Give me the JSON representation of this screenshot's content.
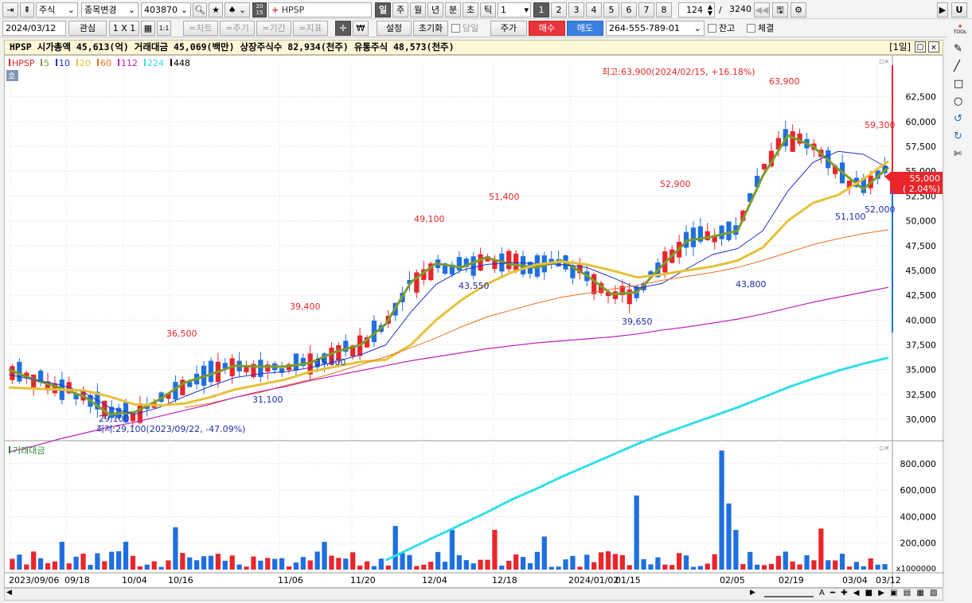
{
  "toolbar1": {
    "asset_type": "주식",
    "change_label": "종목변경",
    "code": "403870",
    "symbol": "HPSP",
    "periods": [
      "일",
      "주",
      "월",
      "년",
      "분",
      "초",
      "틱"
    ],
    "period_value": "1",
    "n_buttons": [
      "1",
      "2",
      "3",
      "4",
      "5",
      "6",
      "7",
      "8"
    ],
    "count": "124",
    "total": "3240",
    "right_btn": "U"
  },
  "toolbar2": {
    "date": "2024/03/12",
    "fav": "관심",
    "layout": "1 X 1",
    "one_one": "1:1",
    "chart_btns": [
      "=차트",
      "=주기",
      "=기간",
      "=지표"
    ],
    "settings": "설정",
    "reset": "초기화",
    "sameday": "당일",
    "price": "주가",
    "buy": "매수",
    "sell": "매도",
    "account": "264-555-789-01",
    "balance": "잔고",
    "fill": "체결"
  },
  "infobar": {
    "text": "HPSP  시가총액 45,613(억)  거래대금 45,069(백만)  상장주식수 82,934(천주)  유통주식 48,573(천주)",
    "period_tag": "[1일]"
  },
  "legend": {
    "items": [
      {
        "label": "HPSP",
        "color": "#e8262c"
      },
      {
        "label": "5",
        "color": "#7c9c2c"
      },
      {
        "label": "10",
        "color": "#2230c8"
      },
      {
        "label": "20",
        "color": "#e6c13a"
      },
      {
        "label": "60",
        "color": "#f07020"
      },
      {
        "label": "112",
        "color": "#c020c0"
      },
      {
        "label": "224",
        "color": "#30e0e8"
      },
      {
        "label": "448",
        "color": "#000000"
      }
    ],
    "ho": "호"
  },
  "colors": {
    "up": "#e8262c",
    "down": "#1f6fe0",
    "grid": "#d8d8d8"
  },
  "volume_label": "거래대금",
  "volume_unit": "x1000000",
  "price_tag": {
    "price": "55,000",
    "change": "( 2.04%)"
  },
  "chart_data": [
    {
      "type": "candlestick",
      "title": "HPSP",
      "ylim": [
        28000,
        66000
      ],
      "yticks": [
        30000,
        32500,
        35000,
        37500,
        40000,
        42500,
        45000,
        47500,
        50000,
        52500,
        55000,
        57500,
        60000,
        62500
      ],
      "ytick_labels": [
        "30,000",
        "32,500",
        "35,000",
        "37,500",
        "40,000",
        "42,500",
        "45,000",
        "47,500",
        "50,000",
        "52,500",
        "55,000",
        "57,500",
        "60,000",
        "62,500"
      ],
      "xticks": [
        "2023/09/06",
        "09/18",
        "10/04",
        "10/16",
        "11/06",
        "11/20",
        "12/04",
        "12/18",
        "2024/01/02",
        "01/15",
        "02/05",
        "02/19",
        "03/04",
        "03/12"
      ],
      "annotations": [
        {
          "label": "63,900",
          "kind": "high"
        },
        {
          "label": "최고:63,900(2024/02/15, +16.18%)",
          "kind": "high_note"
        },
        {
          "label": "29,100",
          "kind": "low"
        },
        {
          "label": "최저:29,100(2023/09/22, -47.09%)",
          "kind": "low_note"
        },
        {
          "label": "36,500",
          "kind": "high"
        },
        {
          "label": "31,100",
          "kind": "low"
        },
        {
          "label": "39,400",
          "kind": "high"
        },
        {
          "label": "35,300",
          "kind": "low"
        },
        {
          "label": "49,100",
          "kind": "high"
        },
        {
          "label": "43,550",
          "kind": "low"
        },
        {
          "label": "51,400",
          "kind": "high"
        },
        {
          "label": "39,650",
          "kind": "low"
        },
        {
          "label": "52,900",
          "kind": "high"
        },
        {
          "label": "43,800",
          "kind": "low"
        },
        {
          "label": "59,300",
          "kind": "high"
        },
        {
          "label": "51,100",
          "kind": "low"
        },
        {
          "label": "52,000",
          "kind": "low"
        }
      ],
      "series": [
        {
          "name": "5",
          "kind": "ma",
          "values": [
            35000,
            34000,
            33200,
            32300,
            30500,
            30700,
            32000,
            33700,
            34500,
            35400,
            35300,
            35300,
            35700,
            36800,
            37500,
            39600,
            43800,
            45700,
            45300,
            46300,
            45600,
            45300,
            46000,
            44500,
            42600,
            42800,
            45500,
            48000,
            48400,
            49000,
            54500,
            58600,
            57500,
            55200,
            53200,
            55400
          ]
        },
        {
          "name": "10",
          "kind": "ma",
          "values": [
            34500,
            34000,
            33500,
            32700,
            31200,
            30500,
            31200,
            32300,
            33300,
            34200,
            34600,
            34800,
            35200,
            35800,
            36500,
            37500,
            40800,
            43600,
            45000,
            45600,
            45800,
            45700,
            45600,
            45300,
            44300,
            43200,
            43700,
            45200,
            46600,
            47200,
            49000,
            53000,
            55900,
            57000,
            56700,
            55300
          ]
        },
        {
          "name": "20",
          "kind": "ma",
          "values": [
            33200,
            33100,
            33000,
            32900,
            32300,
            31500,
            31400,
            31600,
            32200,
            33000,
            33500,
            34000,
            34800,
            35300,
            35800,
            36000,
            37500,
            40000,
            42000,
            43600,
            44800,
            45600,
            45900,
            45600,
            45000,
            44300,
            44600,
            45000,
            45400,
            46000,
            47300,
            50000,
            51800,
            52600,
            54200,
            56000
          ]
        },
        {
          "name": "60",
          "kind": "ma",
          "values": [
            null,
            null,
            null,
            null,
            null,
            null,
            null,
            31200,
            31600,
            32200,
            32700,
            33400,
            34000,
            34700,
            35500,
            36300,
            37200,
            38200,
            39300,
            40300,
            41000,
            41700,
            42300,
            42700,
            43100,
            43500,
            44000,
            44400,
            44800,
            45300,
            46000,
            46800,
            47600,
            48200,
            48700,
            49100
          ]
        },
        {
          "name": "112",
          "kind": "ma",
          "values": [
            26700,
            27300,
            28000,
            28600,
            29200,
            29700,
            30300,
            30900,
            31500,
            32200,
            32800,
            33300,
            33900,
            34400,
            34900,
            35400,
            35900,
            36300,
            36700,
            37100,
            37400,
            37700,
            37900,
            38100,
            38300,
            38600,
            39000,
            39300,
            39700,
            40100,
            40600,
            41200,
            41800,
            42300,
            42800,
            43300
          ]
        },
        {
          "name": "224",
          "kind": "ma",
          "values": [
            null,
            null,
            null,
            null,
            null,
            null,
            null,
            null,
            null,
            null,
            null,
            null,
            null,
            null,
            null,
            15800,
            17000,
            18200,
            19400,
            20600,
            21900,
            23000,
            24200,
            25300,
            26400,
            27500,
            28500,
            29400,
            30300,
            31200,
            32200,
            33200,
            34100,
            34900,
            35600,
            36200
          ]
        }
      ]
    },
    {
      "type": "bar",
      "title": "거래대금",
      "ylim": [
        0,
        950000
      ],
      "yticks": [
        200000,
        400000,
        600000,
        800000
      ],
      "ytick_labels": [
        "200,000",
        "400,000",
        "600,000",
        "800,000"
      ],
      "unit": "x1000000"
    }
  ]
}
